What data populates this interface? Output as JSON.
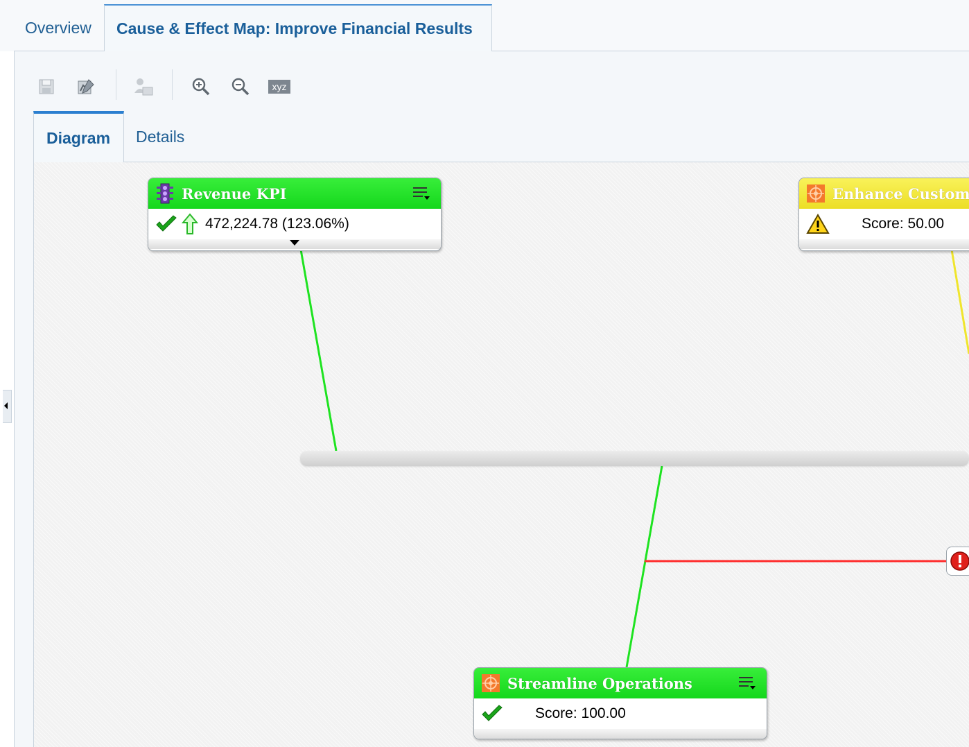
{
  "tabs": {
    "overview": "Overview",
    "map": "Cause & Effect Map: Improve Financial Results"
  },
  "toolbar": {
    "buttons": [
      "save-icon",
      "edit-diagram-icon",
      "user-permissions-icon",
      "zoom-in-icon",
      "zoom-out-icon",
      "text-label-icon"
    ],
    "xyz_label": "xyz"
  },
  "inner_tabs": {
    "diagram": "Diagram",
    "details": "Details"
  },
  "nodes": {
    "revenue_kpi": {
      "title": "Revenue KPI",
      "status_icon": "green-check-icon",
      "trend_icon": "up-arrow-icon",
      "value": "472,224.78 (123.06%)",
      "color": "#1ee320"
    },
    "enhance_customer": {
      "title": "Enhance Custome",
      "status_icon": "warning-icon",
      "value": "Score: 50.00",
      "color": "#f0e52c"
    },
    "streamline_operations": {
      "title": "Streamline Operations",
      "status_icon": "green-check-icon",
      "value": "Score: 100.00",
      "color": "#1ee320"
    }
  },
  "links": {
    "green": "#1ee320",
    "yellow": "#f0e52c",
    "red": "#ff2b2b"
  }
}
